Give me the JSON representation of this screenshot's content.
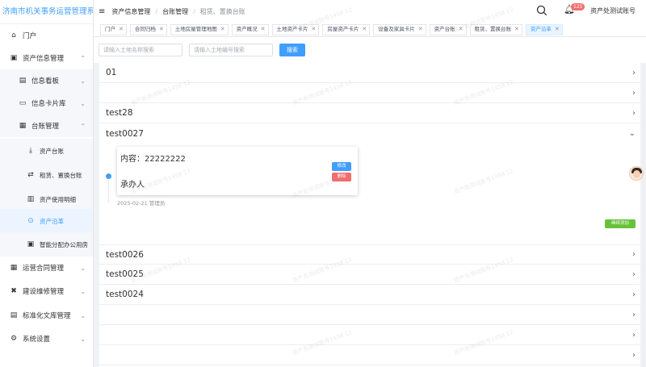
{
  "app": {
    "brand": "济南市机关事务运营管理系统"
  },
  "sidebar": {
    "items": [
      {
        "label": "门户",
        "icon": "home-icon"
      },
      {
        "label": "资产信息管理",
        "icon": "asset-icon"
      },
      {
        "label": "信息看板",
        "icon": "dashboard-icon"
      },
      {
        "label": "信息卡片库",
        "icon": "card-icon"
      },
      {
        "label": "台账管理",
        "icon": "ledger-icon"
      },
      {
        "label": "资产台账",
        "icon": "download-icon"
      },
      {
        "label": "租赁、置换台账",
        "icon": "swap-icon"
      },
      {
        "label": "资产使用明细",
        "icon": "detail-icon"
      },
      {
        "label": "资产沿革",
        "icon": "history-icon"
      },
      {
        "label": "智能分配办公用房",
        "icon": "office-icon"
      },
      {
        "label": "运营合同管理",
        "icon": "contract-icon"
      },
      {
        "label": "建设维修管理",
        "icon": "tools-icon"
      },
      {
        "label": "标准化文库管理",
        "icon": "library-icon"
      },
      {
        "label": "系统设置",
        "icon": "gear-icon"
      }
    ]
  },
  "header": {
    "breadcrumb": [
      "资产信息管理",
      "台账管理",
      "租赁、置换台账"
    ],
    "notification_count": "125",
    "user": "资产处测试账号"
  },
  "tabs": [
    {
      "label": "门户"
    },
    {
      "label": "合同归档"
    },
    {
      "label": "土地房屋管理地图"
    },
    {
      "label": "资产概况"
    },
    {
      "label": "土地资产卡片"
    },
    {
      "label": "房屋资产卡片"
    },
    {
      "label": "设备及家具卡片"
    },
    {
      "label": "资产台账"
    },
    {
      "label": "租赁、置换台账"
    },
    {
      "label": "资产沿革"
    }
  ],
  "filters": {
    "land_name_placeholder": "请输入土地名称搜索",
    "land_code_placeholder": "请输入土地编号搜索",
    "search_label": "搜索"
  },
  "records": [
    {
      "title": "01"
    },
    {
      "title": ""
    },
    {
      "title": "test28"
    },
    {
      "title": "test0027"
    },
    {
      "title": "test0026"
    },
    {
      "title": "test0025"
    },
    {
      "title": "test0024"
    },
    {
      "title": ""
    },
    {
      "title": ""
    },
    {
      "title": ""
    }
  ],
  "expanded_entry": {
    "content": "内容：22222222",
    "handler": "承办人",
    "edit_label": "修改",
    "delete_label": "删除",
    "meta": "2025-02-21 管理员",
    "continue_label": "继续添加"
  },
  "watermark": "资产处测试账号1458 12",
  "colors": {
    "primary": "#409eff",
    "danger": "#f56c6c",
    "success": "#67c23a"
  }
}
